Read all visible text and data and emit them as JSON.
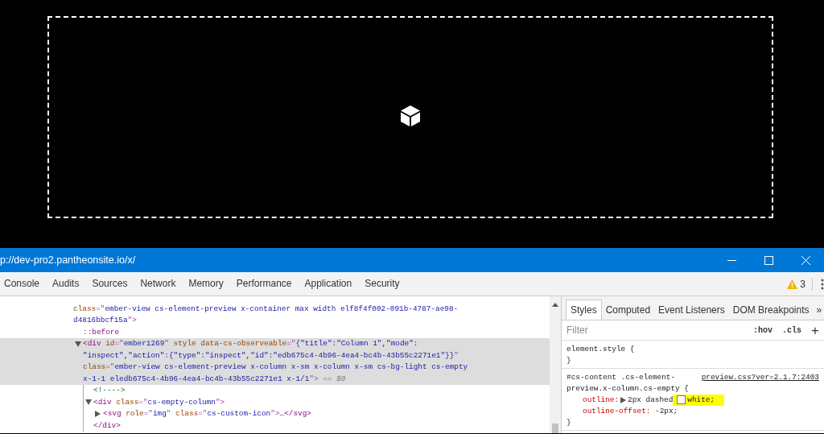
{
  "window": {
    "title": "p://dev-pro2.pantheonsite.io/x/"
  },
  "tabs": [
    {
      "label": "Console",
      "selected": false
    },
    {
      "label": "Audits",
      "selected": false
    },
    {
      "label": "Sources",
      "selected": false
    },
    {
      "label": "Network",
      "selected": false
    },
    {
      "label": "Memory",
      "selected": false
    },
    {
      "label": "Performance",
      "selected": false
    },
    {
      "label": "Application",
      "selected": false
    },
    {
      "label": "Security",
      "selected": false
    }
  ],
  "warnings": "3",
  "elements": [
    {
      "lines": [
        [
          {
            "kind": "attr",
            "text": "class"
          },
          {
            "kind": "punct",
            "text": "=\""
          },
          {
            "kind": "value",
            "text": "ember-view cs-element-preview x-container max width elf8f4f002-091b-4787-ae98-"
          }
        ],
        [
          {
            "kind": "value",
            "text": "d4816bbcf15a"
          },
          {
            "kind": "punct",
            "text": "\">"
          }
        ]
      ],
      "children": [
        {
          "lines": [
            [
              {
                "kind": "pseudo",
                "text": "::before"
              }
            ]
          ]
        },
        {
          "selected": true,
          "expanded": true,
          "lines": [
            [
              {
                "kind": "tag",
                "text": "<div "
              },
              {
                "kind": "attr",
                "text": "id"
              },
              {
                "kind": "punct",
                "text": "=\""
              },
              {
                "kind": "value",
                "text": "ember1269"
              },
              {
                "kind": "punct",
                "text": "\" "
              },
              {
                "kind": "attr",
                "text": "style data-cs-observeable"
              },
              {
                "kind": "punct",
                "text": "=\""
              },
              {
                "kind": "value",
                "text": "{\"title\":\"Column 1\",\"mode\":"
              }
            ],
            [
              {
                "kind": "value",
                "text": "\"inspect\",\"action\":{\"type\":\"inspect\",\"id\":\"edb675c4-4b96-4ea4-bc4b-43b55c2271e1\"}}"
              },
              {
                "kind": "punct",
                "text": "\""
              }
            ],
            [
              {
                "kind": "attr",
                "text": "class"
              },
              {
                "kind": "punct",
                "text": "=\""
              },
              {
                "kind": "value",
                "text": "ember-view cs-element-preview x-column x-sm x-column x-sm cs-bg-light cs-empty"
              }
            ],
            [
              {
                "kind": "value",
                "text": "x-1-1 eledb675c4-4b96-4ea4-bc4b-43b55c2271e1 x-1/1"
              },
              {
                "kind": "punct",
                "text": "\">"
              },
              {
                "kind": "dim",
                "text": " == $0"
              }
            ]
          ],
          "children": [
            {
              "lines": [
                [
                  {
                    "kind": "comment",
                    "text": "<!---->"
                  }
                ]
              ]
            },
            {
              "expanded": true,
              "lines": [
                [
                  {
                    "kind": "tag",
                    "text": "<div "
                  },
                  {
                    "kind": "attr",
                    "text": "class"
                  },
                  {
                    "kind": "punct",
                    "text": "=\""
                  },
                  {
                    "kind": "value",
                    "text": "cs-empty-column"
                  },
                  {
                    "kind": "punct",
                    "text": "\">"
                  }
                ]
              ],
              "children": [
                {
                  "expanded": false,
                  "lines": [
                    [
                      {
                        "kind": "tag",
                        "text": "<svg "
                      },
                      {
                        "kind": "attr",
                        "text": "role"
                      },
                      {
                        "kind": "punct",
                        "text": "=\""
                      },
                      {
                        "kind": "value",
                        "text": "img"
                      },
                      {
                        "kind": "punct",
                        "text": "\" "
                      },
                      {
                        "kind": "attr",
                        "text": "class"
                      },
                      {
                        "kind": "punct",
                        "text": "=\""
                      },
                      {
                        "kind": "value",
                        "text": "cs-custom-icon"
                      },
                      {
                        "kind": "punct",
                        "text": "\">"
                      },
                      {
                        "kind": "text",
                        "text": "…"
                      },
                      {
                        "kind": "tag",
                        "text": "</svg>"
                      }
                    ]
                  ]
                }
              ],
              "close": [
                {
                  "kind": "tag",
                  "text": "</div>"
                }
              ]
            }
          ]
        }
      ]
    }
  ],
  "side_tabs": [
    {
      "label": "Styles",
      "selected": true
    },
    {
      "label": "Computed",
      "selected": false
    },
    {
      "label": "Event Listeners",
      "selected": false
    },
    {
      "label": "DOM Breakpoints",
      "selected": false
    }
  ],
  "side_more": "»",
  "filter": {
    "placeholder": "Filter",
    "hov": ":hov",
    "cls": ".cls",
    "add": "+"
  },
  "rules": [
    {
      "selector": "element.style {",
      "close": "}"
    },
    {
      "selector": "#cs-content .cs-element-preview.x-column.cs-empty {",
      "source": "preview.css?ver=2.1.7:2403",
      "close": "}",
      "props": [
        {
          "name": "outline",
          "colon": ":",
          "expandable": true,
          "value": "2px dashed",
          "color_text": "white;",
          "highlighted": true
        },
        {
          "name": "outline-offset",
          "colon": ":",
          "expandable": false,
          "value": " -2px;",
          "highlighted": false
        }
      ]
    }
  ]
}
